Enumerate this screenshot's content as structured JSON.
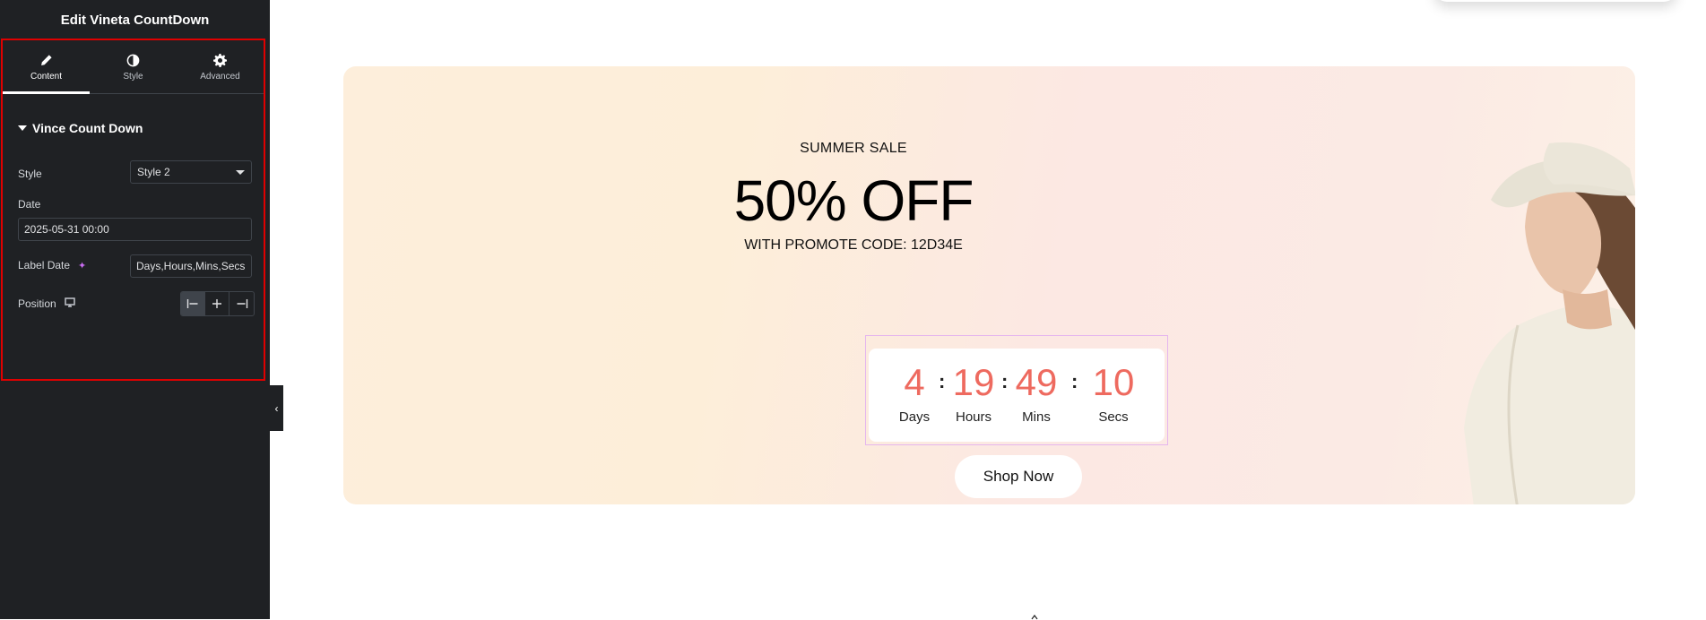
{
  "panel": {
    "title": "Edit Vineta CountDown",
    "tabs": [
      {
        "label": "Content",
        "icon": "pencil-icon",
        "active": true
      },
      {
        "label": "Style",
        "icon": "half-circle-icon",
        "active": false
      },
      {
        "label": "Advanced",
        "icon": "gear-icon",
        "active": false
      }
    ],
    "section_title": "Vince Count Down",
    "style_label": "Style",
    "style_value": "Style 2",
    "date_label": "Date",
    "date_value": "2025-05-31 00:00",
    "label_date_label": "Label Date",
    "label_date_value": "Days,Hours,Mins,Secs",
    "position_label": "Position",
    "position_selected": "left",
    "highlight_color": "#e00000",
    "collapse_icon": "chevron-left-icon"
  },
  "banner": {
    "eyebrow": "SUMMER SALE",
    "headline": "50% OFF",
    "promo": "WITH PROMOTE CODE: 12D34E",
    "countdown": [
      {
        "value": "4",
        "label": "Days"
      },
      {
        "value": "19",
        "label": "Hours"
      },
      {
        "value": "49",
        "label": "Mins"
      },
      {
        "value": "10",
        "label": "Secs"
      }
    ],
    "separator": ":",
    "number_color": "#ee6a5f",
    "button_label": "Shop Now"
  }
}
